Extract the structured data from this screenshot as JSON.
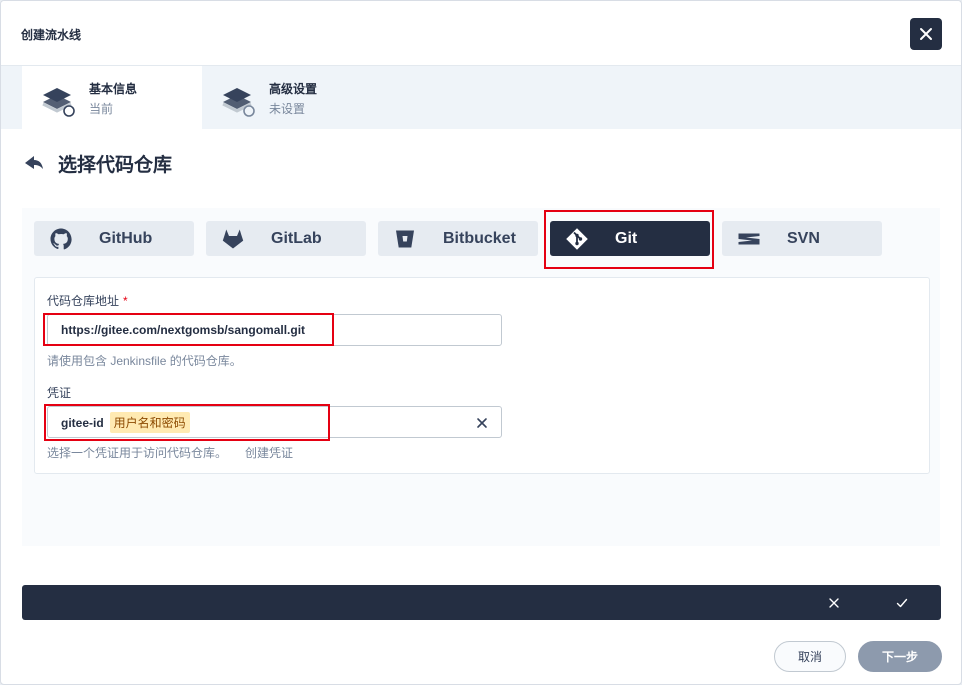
{
  "dialog": {
    "title": "创建流水线"
  },
  "steps": [
    {
      "name": "基本信息",
      "status": "当前"
    },
    {
      "name": "高级设置",
      "status": "未设置"
    }
  ],
  "section": {
    "title": "选择代码仓库"
  },
  "repo_types": [
    {
      "label": "GitHub",
      "icon": "github-icon"
    },
    {
      "label": "GitLab",
      "icon": "gitlab-icon"
    },
    {
      "label": "Bitbucket",
      "icon": "bitbucket-icon"
    },
    {
      "label": "Git",
      "icon": "git-icon",
      "selected": true
    },
    {
      "label": "SVN",
      "icon": "svn-icon"
    }
  ],
  "form": {
    "repo_url": {
      "label": "代码仓库地址",
      "required_mark": "*",
      "value": "https://gitee.com/nextgomsb/sangomall.git",
      "hint": "请使用包含 Jenkinsfile 的代码仓库。"
    },
    "credential": {
      "label": "凭证",
      "value": "gitee-id",
      "tag": "用户名和密码",
      "hint": "选择一个凭证用于访问代码仓库。",
      "create_link": "创建凭证"
    }
  },
  "footer": {
    "cancel_label": "取消",
    "next_label": "下一步"
  },
  "colors": {
    "primary_dark": "#242e42",
    "highlight_red": "#e50012",
    "tag_bg": "#ffeab2",
    "disabled_button": "#8d9aad"
  }
}
